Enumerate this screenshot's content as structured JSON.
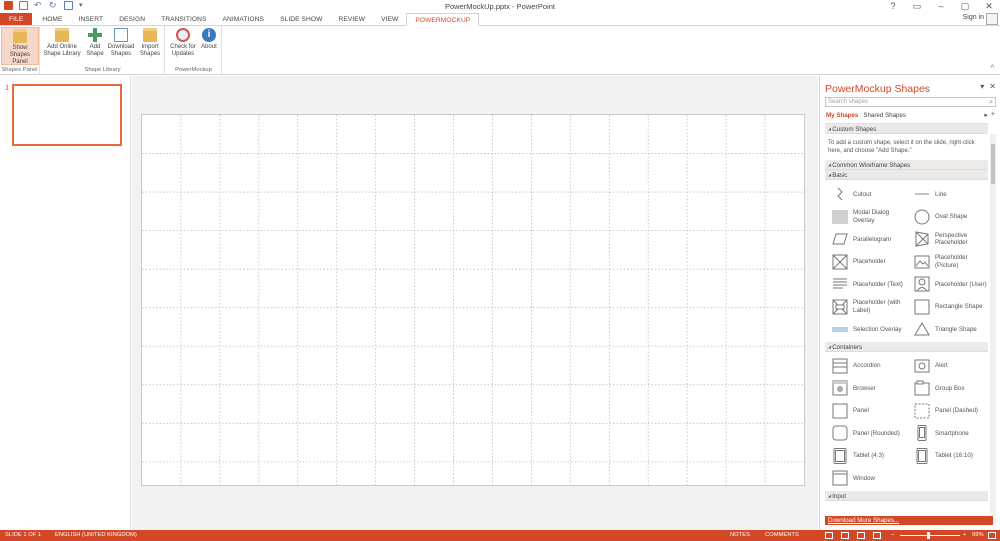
{
  "window": {
    "title": "PowerMockUp.pptx - PowerPoint",
    "controls": [
      "?",
      "▭",
      "–",
      "▢",
      "✕"
    ]
  },
  "ribbon_tabs": [
    "FILE",
    "HOME",
    "INSERT",
    "DESIGN",
    "TRANSITIONS",
    "ANIMATIONS",
    "SLIDE SHOW",
    "REVIEW",
    "VIEW",
    "POWERMOCKUP"
  ],
  "active_tab": "POWERMOCKUP",
  "signin": "Sign in",
  "ribbon": {
    "groups": [
      {
        "label": "Shapes Panel",
        "buttons": [
          {
            "label_1": "Show",
            "label_2": "Shapes Panel",
            "icon": "folder-icon",
            "selected": true
          }
        ]
      },
      {
        "label": "Shape Library",
        "buttons": [
          {
            "label_1": "Add Online",
            "label_2": "Shape Library",
            "icon": "folder-icon"
          },
          {
            "label_1": "Add",
            "label_2": "Shape",
            "icon": "plus-icon"
          },
          {
            "label_1": "Download",
            "label_2": "Shapes",
            "icon": "download-icon"
          },
          {
            "label_1": "Import",
            "label_2": "Shapes",
            "icon": "import-icon"
          }
        ]
      },
      {
        "label": "PowerMockup",
        "buttons": [
          {
            "label_1": "Check for",
            "label_2": "Updates",
            "icon": "update-icon"
          },
          {
            "label_1": "About",
            "label_2": "",
            "icon": "info-icon"
          }
        ]
      }
    ]
  },
  "slides": {
    "number": "1"
  },
  "task_pane": {
    "title": "PowerMockup Shapes",
    "search_placeholder": "Search shapes",
    "library_tabs": [
      "My Shapes",
      "Shared Shapes"
    ],
    "sections": {
      "custom": {
        "title": "Custom Shapes",
        "info": "To add a custom shape, select it on the slide, right-click here, and choose \"Add Shape.\""
      },
      "wireframe": {
        "title": "Common Wireframe Shapes"
      },
      "basic": {
        "title": "Basic",
        "items": [
          "Cutout",
          "Line",
          "Modal Dialog Overlay",
          "Oval Shape",
          "Parallelogram",
          "Perspective Placeholder",
          "Placeholder",
          "Placeholder (Picture)",
          "Placeholder (Text)",
          "Placeholder (User)",
          "Placeholder (with Label)",
          "Rectangle Shape",
          "Selection Overlay",
          "Triangle Shape"
        ]
      },
      "containers": {
        "title": "Containers",
        "items": [
          "Accordion",
          "Alert",
          "Browser",
          "Group Box",
          "Panel",
          "Panel (Dashed)",
          "Panel (Rounded)",
          "Smartphone",
          "Tablet (4:3)",
          "Tablet (16:10)",
          "Window"
        ]
      },
      "input": {
        "title": "Input"
      }
    },
    "download_link": "Download More Shapes..."
  },
  "status_bar": {
    "slide": "SLIDE 1 OF 1",
    "language": "ENGLISH (UNITED KINGDOM)",
    "notes": "NOTES",
    "comments": "COMMENTS",
    "zoom": "99%",
    "zoom_minus": "–",
    "zoom_plus": "+"
  },
  "colors": {
    "accent": "#d24726",
    "accent_light": "#f6d7c8"
  }
}
